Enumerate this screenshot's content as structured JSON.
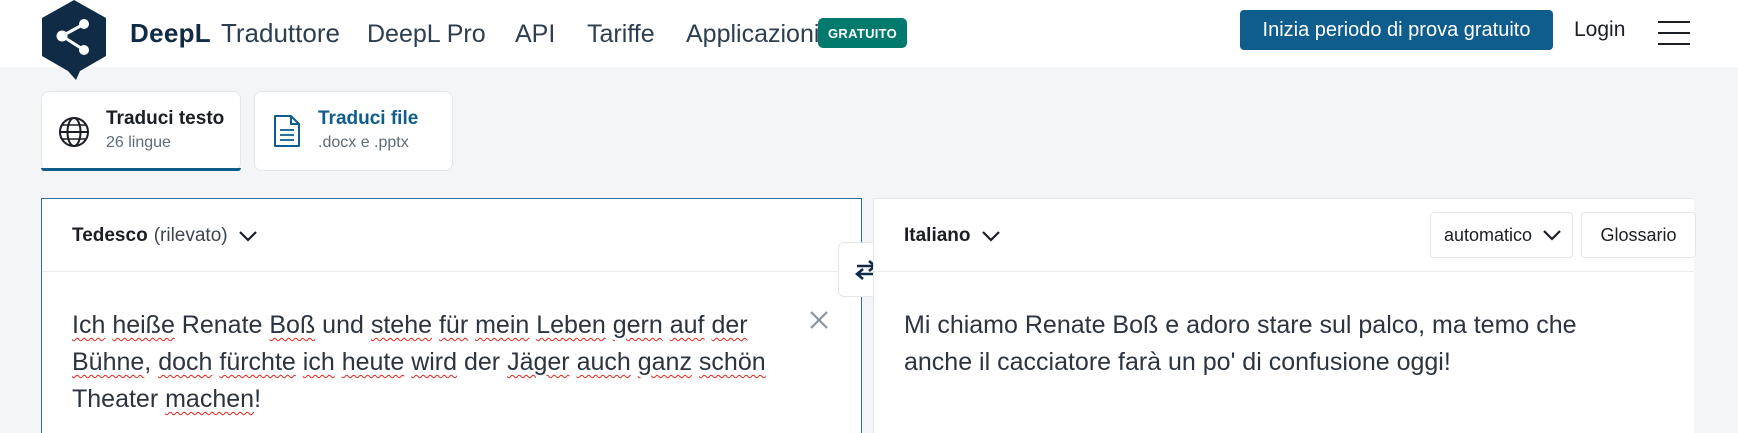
{
  "header": {
    "brand_name": "DeepL",
    "brand_product": "Traduttore",
    "nav": [
      "DeepL Pro",
      "API",
      "Tariffe",
      "Applicazioni"
    ],
    "badge": "GRATUITO",
    "cta": "Inizia periodo di prova gratuito",
    "login": "Login"
  },
  "tabs": [
    {
      "title": "Traduci testo",
      "subtitle": "26 lingue",
      "active": true
    },
    {
      "title": "Traduci file",
      "subtitle": ".docx e .pptx",
      "active": false
    }
  ],
  "source": {
    "language": "Tedesco",
    "detected": "(rilevato)",
    "text_words": [
      {
        "w": "Ich",
        "err": true
      },
      {
        "w": " "
      },
      {
        "w": "heiße",
        "err": true
      },
      {
        "w": " Renate "
      },
      {
        "w": "Boß",
        "err": true
      },
      {
        "w": " und "
      },
      {
        "w": "stehe",
        "err": true
      },
      {
        "w": " "
      },
      {
        "w": "für",
        "err": true
      },
      {
        "w": " "
      },
      {
        "w": "mein",
        "err": true
      },
      {
        "w": " "
      },
      {
        "w": "Leben",
        "err": true
      },
      {
        "w": " "
      },
      {
        "w": "gern",
        "err": true
      },
      {
        "w": " "
      },
      {
        "w": "auf",
        "err": true
      },
      {
        "w": " "
      },
      {
        "w": "der",
        "err": true
      },
      {
        "w": " "
      },
      {
        "w": "Bühne",
        "err": true
      },
      {
        "w": ", "
      },
      {
        "w": "doch",
        "err": true
      },
      {
        "w": " "
      },
      {
        "w": "fürchte",
        "err": true
      },
      {
        "w": " "
      },
      {
        "w": "ich",
        "err": true
      },
      {
        "w": " "
      },
      {
        "w": "heute",
        "err": true
      },
      {
        "w": " "
      },
      {
        "w": "wird",
        "err": true
      },
      {
        "w": " der "
      },
      {
        "w": "Jäger",
        "err": true
      },
      {
        "w": " "
      },
      {
        "w": "auch",
        "err": true
      },
      {
        "w": " "
      },
      {
        "w": "ganz",
        "err": true
      },
      {
        "w": " "
      },
      {
        "w": "schön",
        "err": true
      },
      {
        "w": " Theater "
      },
      {
        "w": "machen",
        "err": true
      },
      {
        "w": "!"
      }
    ]
  },
  "target": {
    "language": "Italiano",
    "formality": "automatico",
    "glossary": "Glossario",
    "text": "Mi chiamo Renate Boß e adoro stare sul palco, ma temo che anche il cacciatore farà un po' di confusione oggi!"
  },
  "colors": {
    "brand": "#0f2b46",
    "accent": "#0f5d8c",
    "badge": "#007a6c",
    "spell_error": "#e0241b"
  }
}
